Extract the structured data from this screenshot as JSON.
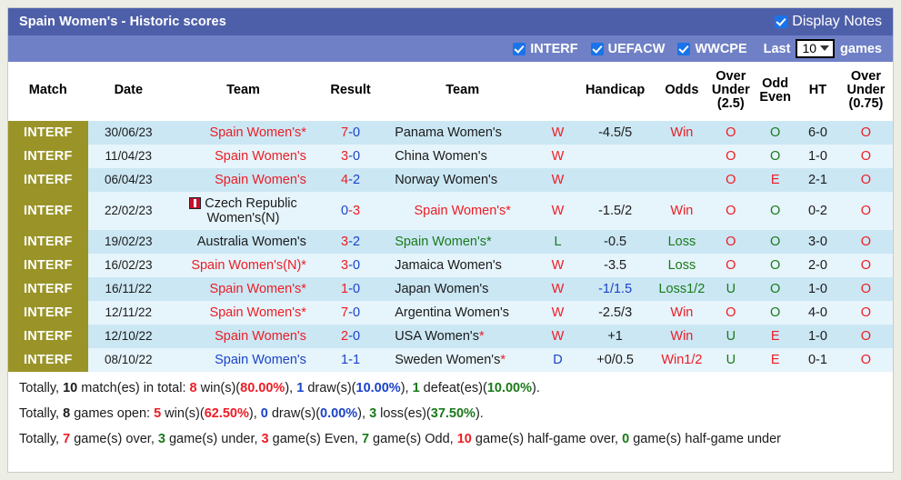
{
  "header": {
    "title": "Spain Women's - Historic scores",
    "display_notes_label": "Display Notes",
    "filters": [
      {
        "label": "INTERF",
        "checked": true
      },
      {
        "label": "UEFACW",
        "checked": true
      },
      {
        "label": "WWCPE",
        "checked": true
      }
    ],
    "last_label": "Last",
    "games_count": "10",
    "games_label": "games"
  },
  "columns": [
    {
      "name": "match",
      "label": "Match"
    },
    {
      "name": "date",
      "label": "Date"
    },
    {
      "name": "team-home",
      "label": "Team"
    },
    {
      "name": "result",
      "label": "Result"
    },
    {
      "name": "team-away",
      "label": "Team"
    },
    {
      "name": "wld",
      "label": ""
    },
    {
      "name": "handicap",
      "label": "Handicap"
    },
    {
      "name": "odds",
      "label": "Odds"
    },
    {
      "name": "over-under-25",
      "label": "Over Under (2.5)"
    },
    {
      "name": "odd-even",
      "label": "Odd Even"
    },
    {
      "name": "ht",
      "label": "HT"
    },
    {
      "name": "over-under-075",
      "label": "Over Under (0.75)"
    }
  ],
  "rows": [
    {
      "league": "INTERF",
      "date": "30/06/23",
      "home": {
        "text": "Spain Women's*",
        "color": "red",
        "align": "right",
        "flag": false
      },
      "score_home": "7",
      "score_sep": "-",
      "score_away": "0",
      "score_home_color": "red",
      "score_away_color": "blue",
      "away": {
        "text": "Panama Women's",
        "color": "black",
        "align": "left",
        "flag": false
      },
      "wld": "W",
      "wld_color": "red",
      "handicap": "-4.5/5",
      "handicap_color": "black",
      "odds": "Win",
      "odds_color": "red",
      "ou25": "O",
      "ou25_color": "red",
      "oddeven": "O",
      "oddeven_color": "green",
      "ht": "6-0",
      "ou075": "O",
      "ou075_color": "red"
    },
    {
      "league": "INTERF",
      "date": "11/04/23",
      "home": {
        "text": "Spain Women's",
        "color": "red",
        "align": "right",
        "flag": false
      },
      "score_home": "3",
      "score_sep": "-",
      "score_away": "0",
      "score_home_color": "red",
      "score_away_color": "blue",
      "away": {
        "text": "China Women's",
        "color": "black",
        "align": "left",
        "flag": false
      },
      "wld": "W",
      "wld_color": "red",
      "handicap": "",
      "handicap_color": "black",
      "odds": "",
      "odds_color": "red",
      "ou25": "O",
      "ou25_color": "red",
      "oddeven": "O",
      "oddeven_color": "green",
      "ht": "1-0",
      "ou075": "O",
      "ou075_color": "red"
    },
    {
      "league": "INTERF",
      "date": "06/04/23",
      "home": {
        "text": "Spain Women's",
        "color": "red",
        "align": "right",
        "flag": false
      },
      "score_home": "4",
      "score_sep": "-",
      "score_away": "2",
      "score_home_color": "red",
      "score_away_color": "blue",
      "away": {
        "text": "Norway Women's",
        "color": "black",
        "align": "left",
        "flag": false
      },
      "wld": "W",
      "wld_color": "red",
      "handicap": "",
      "handicap_color": "black",
      "odds": "",
      "odds_color": "red",
      "ou25": "O",
      "ou25_color": "red",
      "oddeven": "E",
      "oddeven_color": "red",
      "ht": "2-1",
      "ou075": "O",
      "ou075_color": "red"
    },
    {
      "league": "INTERF",
      "date": "22/02/23",
      "home": {
        "text": "Czech Republic Women's(N)",
        "color": "black",
        "align": "center",
        "flag": true
      },
      "score_home": "0",
      "score_sep": "-",
      "score_away": "3",
      "score_home_color": "blue",
      "score_away_color": "red",
      "away": {
        "text": "Spain Women's*",
        "color": "red",
        "align": "center",
        "flag": false
      },
      "wld": "W",
      "wld_color": "red",
      "handicap": "-1.5/2",
      "handicap_color": "black",
      "odds": "Win",
      "odds_color": "red",
      "ou25": "O",
      "ou25_color": "red",
      "oddeven": "O",
      "oddeven_color": "green",
      "ht": "0-2",
      "ou075": "O",
      "ou075_color": "red"
    },
    {
      "league": "INTERF",
      "date": "19/02/23",
      "home": {
        "text": "Australia Women's",
        "color": "black",
        "align": "right",
        "flag": false
      },
      "score_home": "3",
      "score_sep": "-",
      "score_away": "2",
      "score_home_color": "red",
      "score_away_color": "blue",
      "away": {
        "text": "Spain Women's*",
        "color": "green",
        "align": "left",
        "flag": false
      },
      "wld": "L",
      "wld_color": "green",
      "handicap": "-0.5",
      "handicap_color": "black",
      "odds": "Loss",
      "odds_color": "green",
      "ou25": "O",
      "ou25_color": "red",
      "oddeven": "O",
      "oddeven_color": "green",
      "ht": "3-0",
      "ou075": "O",
      "ou075_color": "red"
    },
    {
      "league": "INTERF",
      "date": "16/02/23",
      "home": {
        "text": "Spain Women's(N)*",
        "color": "red",
        "align": "right",
        "flag": false
      },
      "score_home": "3",
      "score_sep": "-",
      "score_away": "0",
      "score_home_color": "red",
      "score_away_color": "blue",
      "away": {
        "text": "Jamaica Women's",
        "color": "black",
        "align": "left",
        "flag": false
      },
      "wld": "W",
      "wld_color": "red",
      "handicap": "-3.5",
      "handicap_color": "black",
      "odds": "Loss",
      "odds_color": "green",
      "ou25": "O",
      "ou25_color": "red",
      "oddeven": "O",
      "oddeven_color": "green",
      "ht": "2-0",
      "ou075": "O",
      "ou075_color": "red"
    },
    {
      "league": "INTERF",
      "date": "16/11/22",
      "home": {
        "text": "Spain Women's*",
        "color": "red",
        "align": "right",
        "flag": false
      },
      "score_home": "1",
      "score_sep": "-",
      "score_away": "0",
      "score_home_color": "red",
      "score_away_color": "blue",
      "away": {
        "text": "Japan Women's",
        "color": "black",
        "align": "left",
        "flag": false
      },
      "wld": "W",
      "wld_color": "red",
      "handicap": "-1/1.5",
      "handicap_color": "blue",
      "odds": "Loss1/2",
      "odds_color": "green",
      "ou25": "U",
      "ou25_color": "green",
      "oddeven": "O",
      "oddeven_color": "green",
      "ht": "1-0",
      "ou075": "O",
      "ou075_color": "red"
    },
    {
      "league": "INTERF",
      "date": "12/11/22",
      "home": {
        "text": "Spain Women's*",
        "color": "red",
        "align": "right",
        "flag": false
      },
      "score_home": "7",
      "score_sep": "-",
      "score_away": "0",
      "score_home_color": "red",
      "score_away_color": "blue",
      "away": {
        "text": "Argentina Women's",
        "color": "black",
        "align": "left",
        "flag": false
      },
      "wld": "W",
      "wld_color": "red",
      "handicap": "-2.5/3",
      "handicap_color": "black",
      "odds": "Win",
      "odds_color": "red",
      "ou25": "O",
      "ou25_color": "red",
      "oddeven": "O",
      "oddeven_color": "green",
      "ht": "4-0",
      "ou075": "O",
      "ou075_color": "red"
    },
    {
      "league": "INTERF",
      "date": "12/10/22",
      "home": {
        "text": "Spain Women's",
        "color": "red",
        "align": "right",
        "flag": false
      },
      "score_home": "2",
      "score_sep": "-",
      "score_away": "0",
      "score_home_color": "red",
      "score_away_color": "blue",
      "away": {
        "text": "USA Women's",
        "color": "black",
        "align": "left",
        "flag": false,
        "star": true
      },
      "wld": "W",
      "wld_color": "red",
      "handicap": "+1",
      "handicap_color": "black",
      "odds": "Win",
      "odds_color": "red",
      "ou25": "U",
      "ou25_color": "green",
      "oddeven": "E",
      "oddeven_color": "red",
      "ht": "1-0",
      "ou075": "O",
      "ou075_color": "red"
    },
    {
      "league": "INTERF",
      "date": "08/10/22",
      "home": {
        "text": "Spain Women's",
        "color": "blue",
        "align": "right",
        "flag": false
      },
      "score_home": "1",
      "score_sep": "-",
      "score_away": "1",
      "score_home_color": "blue",
      "score_away_color": "blue",
      "away": {
        "text": "Sweden Women's",
        "color": "black",
        "align": "left",
        "flag": false,
        "star": true
      },
      "wld": "D",
      "wld_color": "blue",
      "handicap": "+0/0.5",
      "handicap_color": "black",
      "odds": "Win1/2",
      "odds_color": "red",
      "ou25": "U",
      "ou25_color": "green",
      "oddeven": "E",
      "oddeven_color": "red",
      "ht": "0-1",
      "ou075": "O",
      "ou075_color": "red"
    }
  ],
  "summary": {
    "line1": {
      "p1": "Totally, ",
      "n1": "10",
      "p2": " match(es) in total: ",
      "n2": "8",
      "p3": " win(s)(",
      "n3": "80.00%",
      "p4": "), ",
      "n4": "1",
      "p5": " draw(s)(",
      "n5": "10.00%",
      "p6": "), ",
      "n6": "1",
      "p7": " defeat(es)(",
      "n7": "10.00%",
      "p8": ")."
    },
    "line2": {
      "p1": "Totally, ",
      "n1": "8",
      "p2": " games open: ",
      "n2": "5",
      "p3": " win(s)(",
      "n3": "62.50%",
      "p4": "), ",
      "n4": "0",
      "p5": " draw(s)(",
      "n5": "0.00%",
      "p6": "), ",
      "n6": "3",
      "p7": " loss(es)(",
      "n7": "37.50%",
      "p8": ")."
    },
    "line3": {
      "p1": "Totally, ",
      "n1": "7",
      "p2": " game(s) over, ",
      "n2": "3",
      "p3": " game(s) under, ",
      "n3": "3",
      "p4": " game(s) Even, ",
      "n4": "7",
      "p5": " game(s) Odd, ",
      "n5": "10",
      "p6": " game(s) half-game over, ",
      "n6": "0",
      "p7": " game(s) half-game under"
    }
  },
  "colors": {
    "title_bar": "#4e5fa9",
    "option_bar": "#6f80c6",
    "league_badge": "#9a9428",
    "row_odd": "#cbe7f4",
    "row_even": "#e6f4fb",
    "red": "#ed1c24",
    "blue": "#1b43c8",
    "green": "#1a7a1a",
    "checkbox": "#1a73e8"
  }
}
